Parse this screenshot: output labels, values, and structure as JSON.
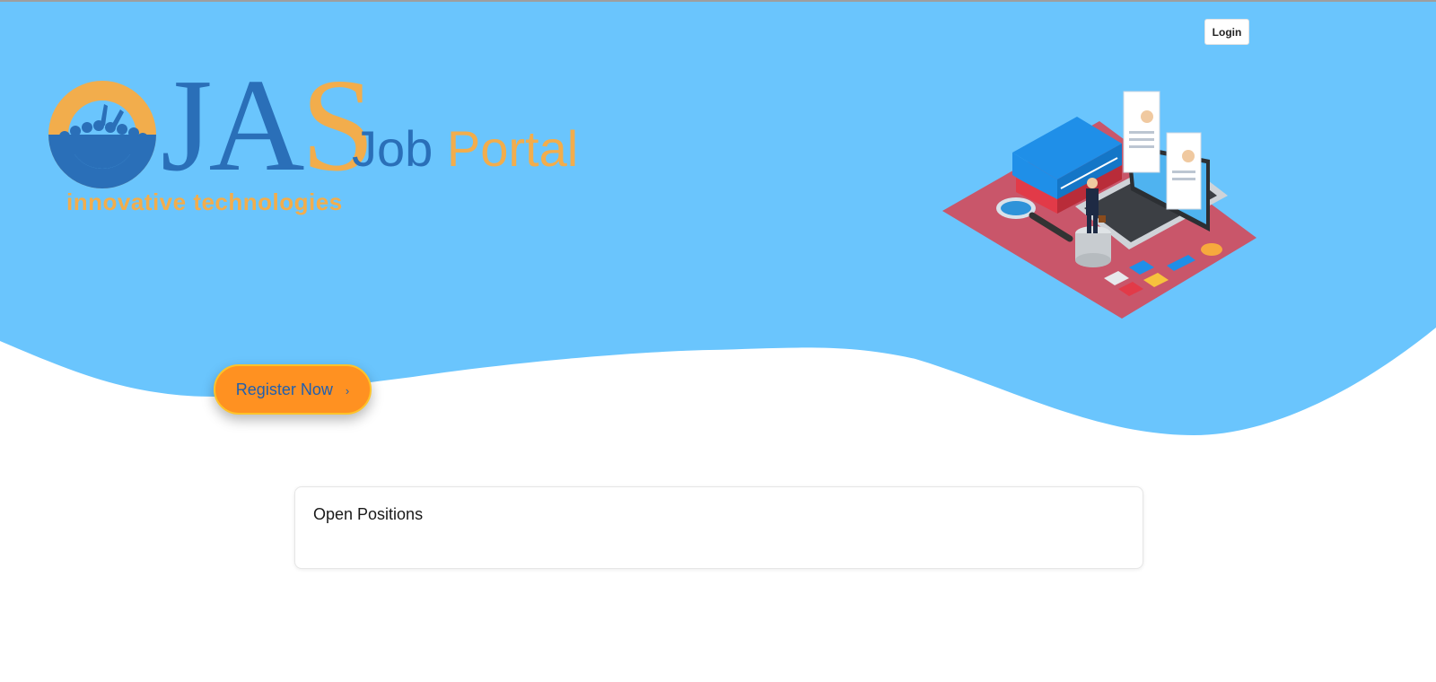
{
  "header": {
    "login_label": "Login"
  },
  "brand": {
    "logo_letters_main": "JA",
    "logo_letters_accent": "S",
    "product_word_1": "Job",
    "product_word_2": "Portal",
    "tagline": "innovative technologies"
  },
  "hero": {
    "register_label": "Register Now",
    "register_icon": "chevron-right-icon",
    "register_chevron": "›",
    "illustration": "isometric-job-search-illustration"
  },
  "positions": {
    "title": "Open Positions",
    "items": []
  },
  "colors": {
    "hero_background": "#6ac5fd",
    "brand_blue": "#2a6fb8",
    "brand_orange": "#f2ad4c",
    "register_fill": "#ff9121",
    "register_border": "#ffc329"
  }
}
